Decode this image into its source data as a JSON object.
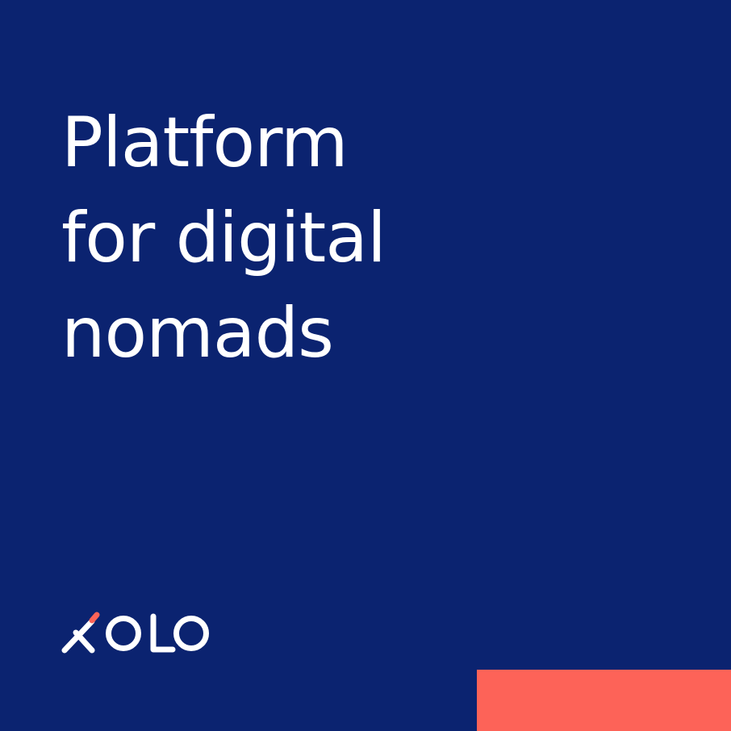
{
  "headline": {
    "lines": [
      "Platform",
      "for digital",
      "nomads"
    ]
  },
  "brand": {
    "name": "XOLO"
  },
  "colors": {
    "background": "#0b2370",
    "text": "#ffffff",
    "accent": "#fd6358"
  }
}
